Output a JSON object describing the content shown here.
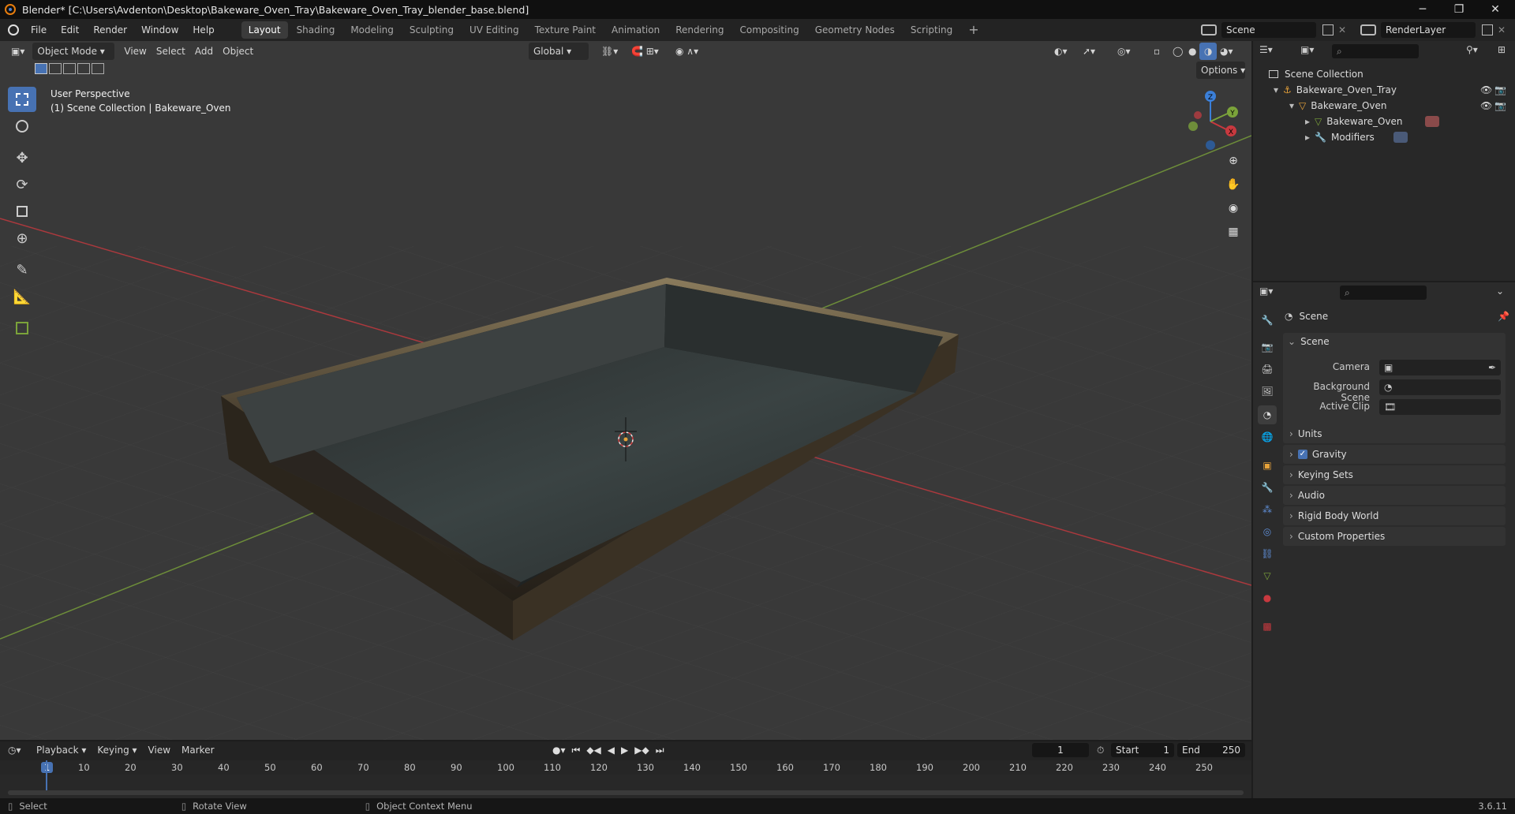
{
  "window": {
    "title": "Blender* [C:\\Users\\Avdenton\\Desktop\\Bakeware_Oven_Tray\\Bakeware_Oven_Tray_blender_base.blend]",
    "minimize": "─",
    "maximize": "❐",
    "close": "✕"
  },
  "menus": [
    "File",
    "Edit",
    "Render",
    "Window",
    "Help"
  ],
  "workspaces": [
    "Layout",
    "Shading",
    "Modeling",
    "Sculpting",
    "UV Editing",
    "Texture Paint",
    "Animation",
    "Rendering",
    "Compositing",
    "Geometry Nodes",
    "Scripting"
  ],
  "active_workspace": "Layout",
  "add_workspace": "+",
  "scene_field": "Scene",
  "renderlayer_field": "RenderLayer",
  "viewport_header": {
    "mode": "Object Mode",
    "menus": [
      "View",
      "Select",
      "Add",
      "Object"
    ],
    "orientation": "Global",
    "options": "Options"
  },
  "viewport_info": {
    "perspective": "User Perspective",
    "collection": "(1) Scene Collection | Bakeware_Oven"
  },
  "gizmo": {
    "z": "Z",
    "y": "Y",
    "x": "X"
  },
  "outliner": {
    "root": "Scene Collection",
    "items": [
      {
        "label": "Bakeware_Oven_Tray",
        "icon": "empty-icon"
      },
      {
        "label": "Bakeware_Oven",
        "icon": "object-icon"
      },
      {
        "label": "Bakeware_Oven",
        "icon": "mesh-icon"
      },
      {
        "label": "Modifiers",
        "icon": "wrench-icon"
      }
    ]
  },
  "properties": {
    "context": "Scene",
    "panel_title": "Scene",
    "camera_label": "Camera",
    "background_scene_label": "Background Scene",
    "active_clip_label": "Active Clip",
    "panels": [
      "Units",
      "Gravity",
      "Keying Sets",
      "Audio",
      "Rigid Body World",
      "Custom Properties"
    ],
    "gravity_checked": true
  },
  "timeline": {
    "menus": [
      "Playback",
      "Keying",
      "View",
      "Marker"
    ],
    "current_frame": "1",
    "start_label": "Start",
    "start_value": "1",
    "end_label": "End",
    "end_value": "250",
    "ruler": [
      "1",
      "10",
      "20",
      "30",
      "40",
      "50",
      "60",
      "70",
      "80",
      "90",
      "100",
      "110",
      "120",
      "130",
      "140",
      "150",
      "160",
      "170",
      "180",
      "190",
      "200",
      "210",
      "220",
      "230",
      "240",
      "250"
    ]
  },
  "statusbar": {
    "select": "Select",
    "rotate": "Rotate View",
    "context_menu": "Object Context Menu",
    "version": "3.6.11"
  },
  "colors": {
    "accent": "#4772b3",
    "x_axis": "#c8393f",
    "y_axis": "#7ba33a",
    "z_axis": "#3b7fd8"
  }
}
